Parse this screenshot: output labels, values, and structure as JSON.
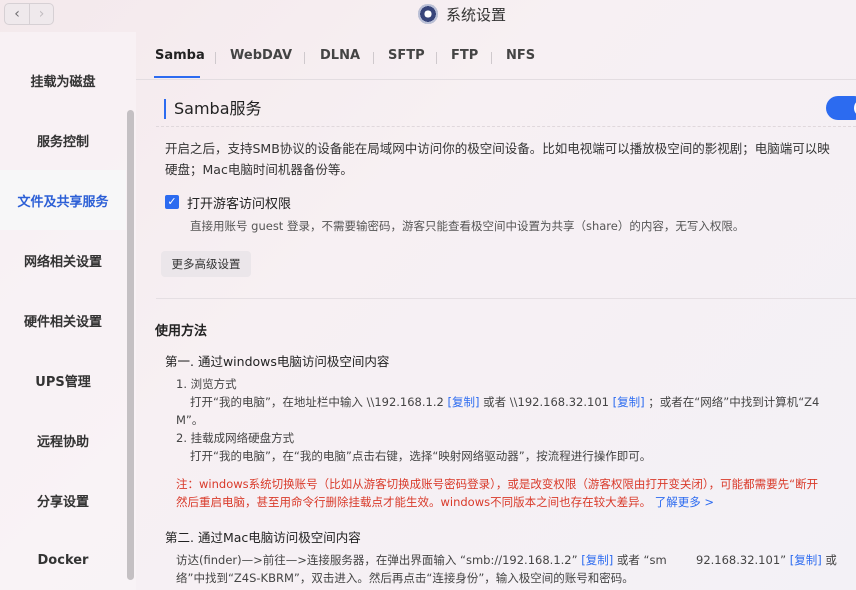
{
  "window": {
    "title": "系统设置",
    "nav_back": "‹",
    "nav_forward": "›"
  },
  "sidebar": {
    "items": [
      {
        "label": "挂载为磁盘"
      },
      {
        "label": "服务控制"
      },
      {
        "label": "文件及共享服务",
        "active": true
      },
      {
        "label": "网络相关设置"
      },
      {
        "label": "硬件相关设置"
      },
      {
        "label": "UPS管理"
      },
      {
        "label": "远程协助"
      },
      {
        "label": "分享设置"
      },
      {
        "label": "Docker"
      }
    ]
  },
  "tabs": [
    "Samba",
    "WebDAV",
    "DLNA",
    "SFTP",
    "FTP",
    "NFS"
  ],
  "samba": {
    "title": "Samba服务",
    "enabled": true,
    "desc_line1": "开启之后，支持SMB协议的设备能在局域网中访问你的极空间设备。比如电视端可以播放极空间的影视剧；电脑端可以映",
    "desc_line2": "硬盘；Mac电脑时间机器备份等。",
    "guest_checkbox_label": "打开游客访问权限",
    "guest_checked": true,
    "guest_desc": "直接用账号 guest 登录，不需要输密码，游客只能查看极空间中设置为共享（share）的内容，无写入权限。",
    "advanced_button": "更多高级设置"
  },
  "usage": {
    "title": "使用方法",
    "step1_title": "第一. 通过windows电脑访问极空间内容",
    "s1_item1": "1. 浏览方式",
    "s1_line1_a": "打开“我的电脑”，在地址栏中输入 \\\\192.168.1.2",
    "s1_copy1": "[复制]",
    "s1_line1_b": "或者 \\\\192.168.32.101",
    "s1_copy2": "[复制]",
    "s1_line1_c": "；或者在“网络”中找到计算机“Z4",
    "s1_line1_wrap": "M”。",
    "s1_item2": "2. 挂载成网络硬盘方式",
    "s1_line2": "打开“我的电脑”，在“我的电脑”点击右键，选择“映射网络驱动器”，按流程进行操作即可。",
    "warn_line1": "注：windows系统切换账号（比如从游客切换成账号密码登录），或是改变权限（游客权限由打开变关闭），可能都需要先“断开",
    "warn_line2": "然后重启电脑，甚至用命令行删除挂载点才能生效。windows不同版本之间也存在较大差异。",
    "learn_more": "了解更多 >",
    "step2_title": "第二. 通过Mac电脑访问极空间内容",
    "s2_line1_a": "访达(finder)—>前往—>连接服务器，在弹出界面输入 “smb://192.168.1.2”",
    "s2_copy1": "[复制]",
    "s2_line1_b": "或者 “sm",
    "s2_line1_c": "92.168.32.101”",
    "s2_copy2": "[复制]",
    "s2_line1_d": "或",
    "s2_line2": "络”中找到“Z4S-KBRM”，双击进入。然后再点击“连接身份”，输入极空间的账号和密码。"
  },
  "colors": {
    "accent": "#2c6bf0",
    "warning": "#d93a2a"
  }
}
